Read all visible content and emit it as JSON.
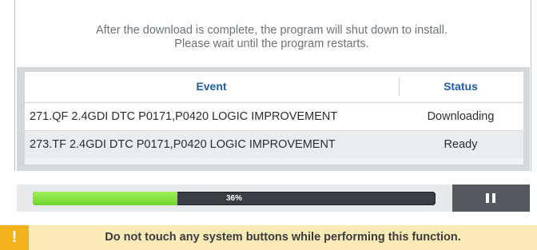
{
  "message": {
    "line1": "After the download is complete, the program will shut down to install.",
    "line2": "Please wait until the program restarts."
  },
  "table": {
    "headers": {
      "event": "Event",
      "status": "Status"
    },
    "rows": [
      {
        "event": "271.QF 2.4GDI DTC P0171,P0420 LOGIC IMPROVEMENT",
        "status": "Downloading"
      },
      {
        "event": "273.TF 2.4GDI DTC P0171,P0420 LOGIC IMPROVEMENT",
        "status": "Ready"
      }
    ]
  },
  "progress": {
    "percent": 36,
    "label": "36%"
  },
  "pause_button": {
    "icon": "pause-icon"
  },
  "warning": {
    "icon": "warning-icon",
    "text": "Do not touch any system buttons while performing this function."
  },
  "colors": {
    "header_text": "#1f5fa8",
    "progress_fill": "#6ed42a",
    "warning_bg": "#fbeab6",
    "warning_icon_bg": "#f3b11b"
  }
}
